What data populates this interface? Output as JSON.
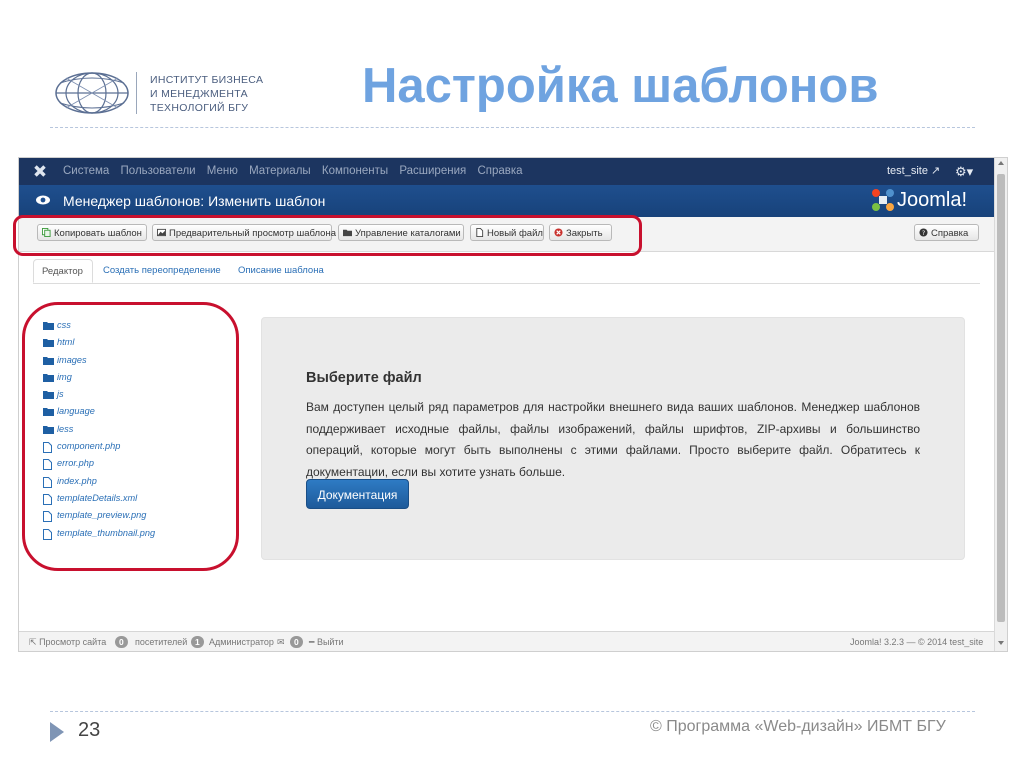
{
  "slide": {
    "logo_lines": [
      "ИНСТИТУТ БИЗНЕСА",
      "И МЕНЕДЖМЕНТА",
      "ТЕХНОЛОГИЙ БГУ"
    ],
    "title": "Настройка шаблонов",
    "page_number": "23",
    "footer": "© Программа «Web-дизайн» ИБМТ БГУ"
  },
  "admin": {
    "topbar": {
      "menu": [
        "Система",
        "Пользователи",
        "Меню",
        "Материалы",
        "Компоненты",
        "Расширения",
        "Справка"
      ],
      "user": "test_site"
    },
    "header": {
      "title": "Менеджер шаблонов: Изменить шаблон",
      "brand": "Joomla!"
    },
    "toolbar": {
      "copy": "Копировать шаблон",
      "preview": "Предварительный просмотр шаблона",
      "folders": "Управление каталогами",
      "new_file": "Новый файл",
      "close": "Закрыть",
      "help": "Справка"
    },
    "tabs": [
      "Редактор",
      "Создать переопределение",
      "Описание шаблона"
    ],
    "tree": [
      {
        "name": "css",
        "type": "folder"
      },
      {
        "name": "html",
        "type": "folder"
      },
      {
        "name": "images",
        "type": "folder"
      },
      {
        "name": "img",
        "type": "folder"
      },
      {
        "name": "js",
        "type": "folder"
      },
      {
        "name": "language",
        "type": "folder"
      },
      {
        "name": "less",
        "type": "folder"
      },
      {
        "name": "component.php",
        "type": "file"
      },
      {
        "name": "error.php",
        "type": "file"
      },
      {
        "name": "index.php",
        "type": "file"
      },
      {
        "name": "templateDetails.xml",
        "type": "file"
      },
      {
        "name": "template_preview.png",
        "type": "file"
      },
      {
        "name": "template_thumbnail.png",
        "type": "file"
      }
    ],
    "panel": {
      "heading": "Выберите файл",
      "text": "Вам доступен целый ряд параметров для настройки внешнего вида ваших шаблонов. Менеджер шаблонов поддерживает исходные файлы, файлы изображений, файлы шрифтов, ZIP-архивы и большинство операций, которые могут быть выполнены с этими файлами. Просто выберите файл. Обратитесь к документации, если вы хотите узнать больше.",
      "button": "Документация"
    },
    "status": {
      "view_site": "Просмотр сайта",
      "visitors_count": "0",
      "visitors": "посетителей",
      "admins_count": "1",
      "admins": "Администратор",
      "messages_count": "0",
      "logout": "Выйти",
      "version": "Joomla! 3.2.3 — © 2014 test_site"
    }
  },
  "colors": {
    "title_blue": "#6fa3e0",
    "highlight_red": "#c8102e",
    "topbar_navy": "#1c3560",
    "header_blue": "#1f4f8e",
    "link_blue": "#2a6fb6"
  }
}
